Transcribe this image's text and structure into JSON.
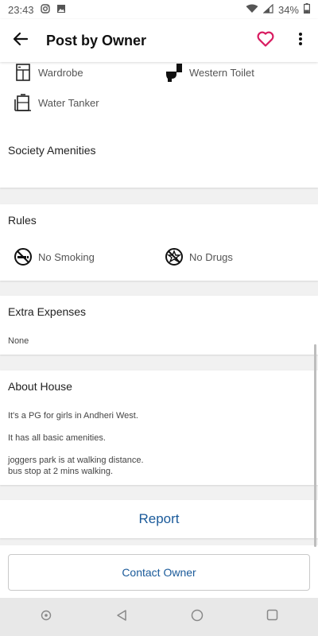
{
  "status_bar": {
    "time": "23:43",
    "battery": "34%"
  },
  "header": {
    "title": "Post by Owner"
  },
  "amenities": {
    "items": [
      {
        "label": "Wardrobe",
        "icon": "wardrobe-icon"
      },
      {
        "label": "Western Toilet",
        "icon": "toilet-icon"
      },
      {
        "label": "Water Tanker",
        "icon": "water-tanker-icon"
      }
    ]
  },
  "society_amenities": {
    "title": "Society Amenities"
  },
  "rules": {
    "title": "Rules",
    "items": [
      {
        "label": "No Smoking",
        "icon": "no-smoking-icon"
      },
      {
        "label": "No Drugs",
        "icon": "no-drugs-icon"
      }
    ]
  },
  "extra_expenses": {
    "title": "Extra Expenses",
    "value": "None"
  },
  "about_house": {
    "title": "About House",
    "lines": [
      "It's a PG for girls in Andheri West.",
      "It has all basic amenities.",
      "joggers park is at walking distance.",
      "bus stop at 2 mins walking."
    ]
  },
  "actions": {
    "report_label": "Report",
    "contact_label": "Contact Owner"
  },
  "colors": {
    "accent": "#1a5a9a",
    "heart": "#d81b60"
  }
}
